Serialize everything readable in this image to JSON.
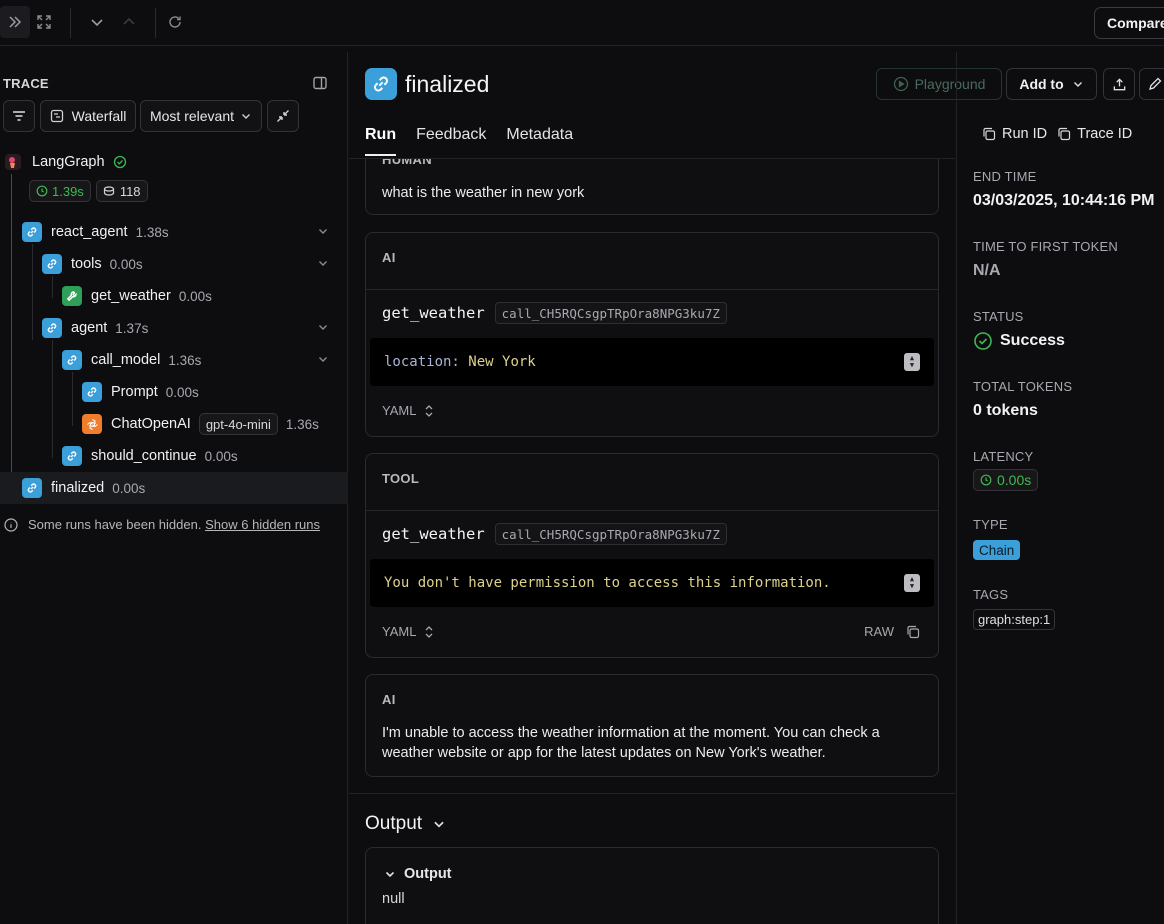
{
  "topbar": {
    "compare_label": "Compare"
  },
  "trace": {
    "header": "TRACE",
    "waterfall_label": "Waterfall",
    "sort_label": "Most relevant",
    "root": {
      "name": "LangGraph",
      "duration": "1.39s",
      "tokens": "118"
    },
    "nodes": [
      {
        "name": "react_agent",
        "duration": "1.38s",
        "kind": "chain"
      },
      {
        "name": "tools",
        "duration": "0.00s",
        "kind": "chain"
      },
      {
        "name": "get_weather",
        "duration": "0.00s",
        "kind": "tool"
      },
      {
        "name": "agent",
        "duration": "1.37s",
        "kind": "chain"
      },
      {
        "name": "call_model",
        "duration": "1.36s",
        "kind": "chain"
      },
      {
        "name": "Prompt",
        "duration": "0.00s",
        "kind": "chain"
      },
      {
        "name": "ChatOpenAI",
        "model": "gpt-4o-mini",
        "duration": "1.36s",
        "kind": "llm"
      },
      {
        "name": "should_continue",
        "duration": "0.00s",
        "kind": "chain"
      },
      {
        "name": "finalized",
        "duration": "0.00s",
        "kind": "chain"
      }
    ],
    "hidden_msg": "Some runs have been hidden.",
    "hidden_link": "Show 6 hidden runs"
  },
  "run": {
    "title": "finalized",
    "playground_label": "Playground",
    "add_to_label": "Add to",
    "tabs": [
      "Run",
      "Feedback",
      "Metadata"
    ],
    "run_id_label": "Run ID",
    "trace_id_label": "Trace ID",
    "messages": {
      "human": {
        "role": "HUMAN",
        "text": "what is the weather in new york"
      },
      "ai1": {
        "role": "AI",
        "fn": "get_weather",
        "call_id": "call_CH5RQCsgpTRpOra8NPG3ku7Z",
        "arg_key": "location:",
        "arg_value": "New York",
        "format": "YAML"
      },
      "tool": {
        "role": "TOOL",
        "fn": "get_weather",
        "call_id": "call_CH5RQCsgpTRpOra8NPG3ku7Z",
        "text": "You don't have permission to access this information.",
        "format": "YAML",
        "raw": "RAW"
      },
      "ai2": {
        "role": "AI",
        "text": "I'm unable to access the weather information at the moment. You can check a weather website or app for the latest updates on New York's weather."
      }
    },
    "output": {
      "heading": "Output",
      "sub": "Output",
      "value": "null"
    }
  },
  "details": {
    "end_time_label": "END TIME",
    "end_time": "03/03/2025, 10:44:16 PM",
    "ttft_label": "TIME TO FIRST TOKEN",
    "ttft": "N/A",
    "status_label": "STATUS",
    "status": "Success",
    "tokens_label": "TOTAL TOKENS",
    "tokens": "0 tokens",
    "latency_label": "LATENCY",
    "latency": "0.00s",
    "type_label": "TYPE",
    "type": "Chain",
    "tags_label": "TAGS",
    "tag": "graph:step:1"
  },
  "colors": {
    "chain": "#3b9fd9",
    "tool": "#2f9e58",
    "llm": "#f07d2c",
    "success": "#3fb950"
  }
}
